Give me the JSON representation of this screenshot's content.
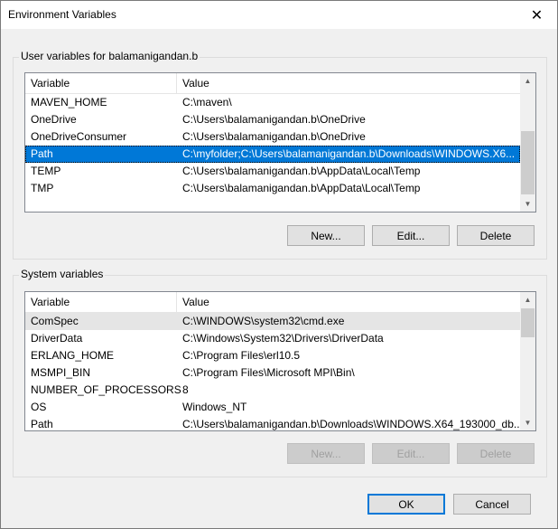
{
  "window": {
    "title": "Environment Variables"
  },
  "user_vars": {
    "group_label": "User variables for balamanigandan.b",
    "columns": {
      "variable": "Variable",
      "value": "Value"
    },
    "rows": [
      {
        "variable": "MAVEN_HOME",
        "value": "C:\\maven\\"
      },
      {
        "variable": "OneDrive",
        "value": "C:\\Users\\balamanigandan.b\\OneDrive"
      },
      {
        "variable": "OneDriveConsumer",
        "value": "C:\\Users\\balamanigandan.b\\OneDrive"
      },
      {
        "variable": "Path",
        "value": "C:\\myfolder;C:\\Users\\balamanigandan.b\\Downloads\\WINDOWS.X6..."
      },
      {
        "variable": "TEMP",
        "value": "C:\\Users\\balamanigandan.b\\AppData\\Local\\Temp"
      },
      {
        "variable": "TMP",
        "value": "C:\\Users\\balamanigandan.b\\AppData\\Local\\Temp"
      }
    ],
    "selected_variable": "Path",
    "buttons": {
      "new": "New...",
      "edit": "Edit...",
      "delete": "Delete"
    }
  },
  "system_vars": {
    "group_label": "System variables",
    "columns": {
      "variable": "Variable",
      "value": "Value"
    },
    "rows": [
      {
        "variable": "ComSpec",
        "value": "C:\\WINDOWS\\system32\\cmd.exe"
      },
      {
        "variable": "DriverData",
        "value": "C:\\Windows\\System32\\Drivers\\DriverData"
      },
      {
        "variable": "ERLANG_HOME",
        "value": "C:\\Program Files\\erl10.5"
      },
      {
        "variable": "MSMPI_BIN",
        "value": "C:\\Program Files\\Microsoft MPI\\Bin\\"
      },
      {
        "variable": "NUMBER_OF_PROCESSORS",
        "value": "8"
      },
      {
        "variable": "OS",
        "value": "Windows_NT"
      },
      {
        "variable": "Path",
        "value": "C:\\Users\\balamanigandan.b\\Downloads\\WINDOWS.X64_193000_db..."
      }
    ],
    "buttons": {
      "new": "New...",
      "edit": "Edit...",
      "delete": "Delete"
    }
  },
  "footer": {
    "ok": "OK",
    "cancel": "Cancel"
  },
  "colors": {
    "selection": "#0078d7",
    "default_button_border": "#0078d7"
  },
  "icons": {
    "close": "close-icon",
    "scroll_up": "chevron-up-icon",
    "scroll_down": "chevron-down-icon"
  }
}
